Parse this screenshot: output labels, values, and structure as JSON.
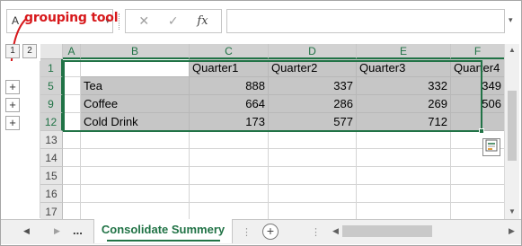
{
  "formula_bar": {
    "name_box_value": "A",
    "name_box_dropdown_icon": "▾",
    "cancel_icon": "✕",
    "enter_icon": "✓",
    "fx_label": "fx",
    "formula_value": "",
    "expand_icon": "▾"
  },
  "annotation": {
    "text": "grouping tool",
    "color": "#d7191c"
  },
  "outline": {
    "level_buttons": [
      "1",
      "2"
    ],
    "expand_buttons": [
      "+",
      "+",
      "+"
    ]
  },
  "columns": [
    "A",
    "B",
    "C",
    "D",
    "E",
    "F"
  ],
  "rows": [
    {
      "header": "1",
      "cells": [
        "",
        "",
        "Quarter1",
        "Quarter2",
        "Quarter3",
        "Quarter4"
      ]
    },
    {
      "header": "5",
      "cells": [
        "",
        "Tea",
        "888",
        "337",
        "332",
        "349"
      ]
    },
    {
      "header": "9",
      "cells": [
        "",
        "Coffee",
        "664",
        "286",
        "269",
        "506"
      ]
    },
    {
      "header": "12",
      "cells": [
        "",
        "Cold Drink",
        "173",
        "577",
        "712",
        ""
      ]
    },
    {
      "header": "13",
      "cells": [
        "",
        "",
        "",
        "",
        "",
        ""
      ]
    },
    {
      "header": "14",
      "cells": [
        "",
        "",
        "",
        "",
        "",
        ""
      ]
    },
    {
      "header": "15",
      "cells": [
        "",
        "",
        "",
        "",
        "",
        ""
      ]
    },
    {
      "header": "16",
      "cells": [
        "",
        "",
        "",
        "",
        "",
        ""
      ]
    },
    {
      "header": "17",
      "cells": [
        "",
        "",
        "",
        "",
        "",
        ""
      ]
    }
  ],
  "tabs": {
    "prev_icon": "◀",
    "next_icon": "▶",
    "more_label": "...",
    "active_sheet": "Consolidate Summery",
    "add_icon": "+",
    "separator": "⋮"
  },
  "theme": {
    "accent": "#217346",
    "selection_fill": "#c6c6c6",
    "header_fill": "#e6e6e6"
  }
}
